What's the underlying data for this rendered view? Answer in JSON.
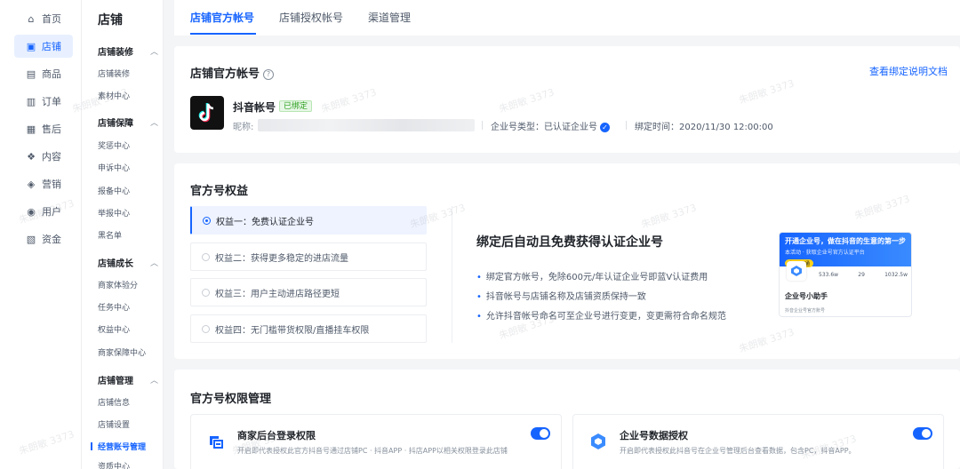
{
  "nav": {
    "items": [
      {
        "label": "首页",
        "icon": "home-icon",
        "glyph": "⌂"
      },
      {
        "label": "店铺",
        "icon": "shop-icon",
        "glyph": "▣"
      },
      {
        "label": "商品",
        "icon": "goods-icon",
        "glyph": "▤"
      },
      {
        "label": "订单",
        "icon": "order-icon",
        "glyph": "▥"
      },
      {
        "label": "售后",
        "icon": "after-sale-icon",
        "glyph": "▦"
      },
      {
        "label": "内容",
        "icon": "content-icon",
        "glyph": "❖"
      },
      {
        "label": "营销",
        "icon": "marketing-icon",
        "glyph": "◈"
      },
      {
        "label": "用户",
        "icon": "user-icon",
        "glyph": "◉"
      },
      {
        "label": "资金",
        "icon": "fund-icon",
        "glyph": "▧"
      }
    ],
    "active_index": 1
  },
  "subnav": {
    "title": "店铺",
    "groups": [
      {
        "label": "店铺装修",
        "items": [
          "店铺装修",
          "素材中心"
        ]
      },
      {
        "label": "店铺保障",
        "items": [
          "奖惩中心",
          "申诉中心",
          "报备中心",
          "举报中心",
          "黑名单"
        ]
      },
      {
        "label": "店铺成长",
        "items": [
          "商家体验分",
          "任务中心",
          "权益中心",
          "商家保障中心"
        ]
      },
      {
        "label": "店铺管理",
        "items": [
          "店铺信息",
          "店铺设置",
          "经营账号管理",
          "资质中心"
        ]
      }
    ],
    "active_item": "经营账号管理"
  },
  "tabs": [
    "店铺官方帐号",
    "店铺授权帐号",
    "渠道管理"
  ],
  "account": {
    "section_title": "店铺官方帐号",
    "doc_link": "查看绑定说明文档",
    "name": "抖音帐号",
    "badge": "已绑定",
    "nickname_label": "昵称:",
    "type_text": "企业号类型：已认证企业号",
    "bind_time": "绑定时间：2020/11/30 12:00:00"
  },
  "benefits": {
    "section_title": "官方号权益",
    "items": [
      "权益一：免费认证企业号",
      "权益二：获得更多稳定的进店流量",
      "权益三：用户主动进店路径更短",
      "权益四：无门槛带货权限/直播挂车权限"
    ],
    "active_index": 0,
    "detail_title": "绑定后自动且免费获得认证企业号",
    "detail_items": [
      "绑定官方帐号，免除600元/年认证企业号即蓝V认证费用",
      "抖音帐号与店铺名称及店铺资质保持一致",
      "允许抖音帐号命名可至企业号进行变更，变更需符合命名规范"
    ],
    "promo": {
      "line1": "开通企业号，做在抖音的生意的第一步",
      "line2": "本活动 · 获取企业号官方认证平台",
      "button": "立即开通",
      "stats": [
        "533.6w",
        "29",
        "1032.5w"
      ],
      "name": "企业号小助手",
      "sub": "抖音企业号官方账号"
    }
  },
  "permissions": {
    "section_title": "官方号权限管理",
    "items": [
      {
        "title": "商家后台登录权限",
        "desc": "开启即代表授权此官方抖音号通过店铺PC · 抖音APP · 抖店APP以相关权限登录此店铺",
        "on": true
      },
      {
        "title": "企业号数据授权",
        "desc": "开启即代表授权此抖音号在企业号管理后台查看数据，包含PC，抖音APP。",
        "on": true
      }
    ]
  },
  "watermark": "朱朗敏 3373",
  "colors": {
    "primary": "#1664ff",
    "success": "#2ea121",
    "background": "#f4f5f7"
  }
}
